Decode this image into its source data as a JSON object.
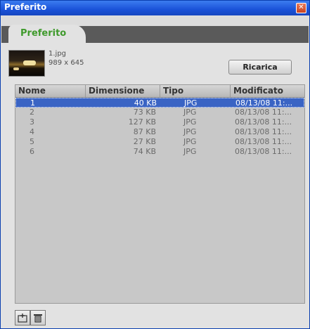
{
  "window": {
    "title": "Preferito",
    "close_symbol": "✕"
  },
  "tabs": [
    {
      "label": "Preferito",
      "active": true
    }
  ],
  "preview": {
    "filename": "1.jpg",
    "dimensions": "989 x 645"
  },
  "toolbar": {
    "reload_label": "Ricarica"
  },
  "list": {
    "columns": [
      "Nome",
      "Dimensione",
      "Tipo",
      "Modificato"
    ],
    "rows": [
      {
        "name": "1",
        "size": "40 KB",
        "type": "JPG",
        "modified": "08/13/08 11:...",
        "selected": true
      },
      {
        "name": "2",
        "size": "73 KB",
        "type": "JPG",
        "modified": "08/13/08 11:..."
      },
      {
        "name": "3",
        "size": "127 KB",
        "type": "JPG",
        "modified": "08/13/08 11:..."
      },
      {
        "name": "4",
        "size": "87 KB",
        "type": "JPG",
        "modified": "08/13/08 11:..."
      },
      {
        "name": "5",
        "size": "27 KB",
        "type": "JPG",
        "modified": "08/13/08 11:..."
      },
      {
        "name": "6",
        "size": "74 KB",
        "type": "JPG",
        "modified": "08/13/08 11:..."
      }
    ]
  },
  "bottom_actions": [
    {
      "icon": "add-folder-icon"
    },
    {
      "icon": "trash-icon"
    }
  ],
  "colors": {
    "accent": "#3a64c4",
    "tab_text": "#3f9a2c",
    "titlebar": "#1a52d8"
  }
}
